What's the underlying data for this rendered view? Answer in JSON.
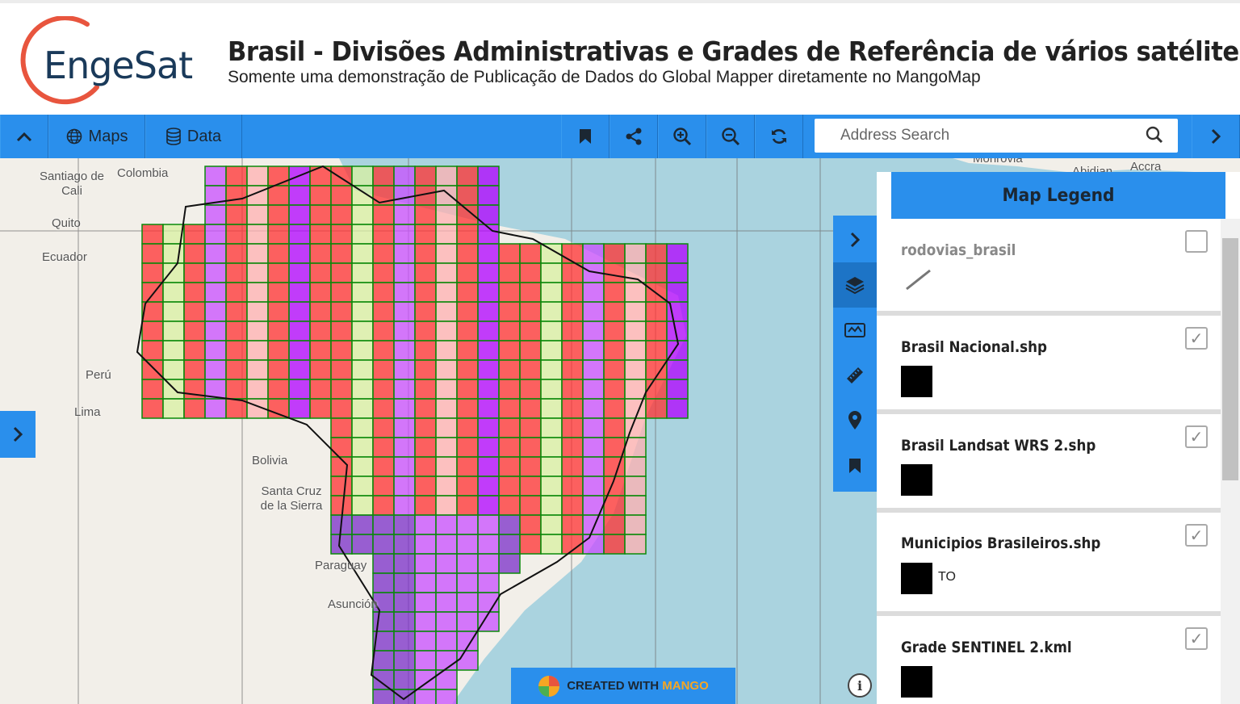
{
  "header": {
    "logo_text": "EngeSat",
    "title": "Brasil - Divisões Administrativas e Grades de Referência de vários satélites...",
    "subtitle": "Somente uma demonstração de Publicação de Dados do Global Mapper diretamente no MangoMap"
  },
  "toolbar": {
    "maps_label": "Maps",
    "data_label": "Data",
    "search_placeholder": "Address Search"
  },
  "map": {
    "place_labels": [
      "Santiago de Cali",
      "Colombia",
      "Quito",
      "Ecuador",
      "Perú",
      "Lima",
      "Bolivia",
      "Santa Cruz de la Sierra",
      "Paraguay",
      "Asunción",
      "Monrovia",
      "Abidjan",
      "Accra"
    ],
    "colors": {
      "grid_red": "#ff0000",
      "grid_green": "#0a8a0a",
      "ocean": "#aad3df",
      "land": "#f2efe9",
      "toolbar": "#2a8fec"
    }
  },
  "legend": {
    "title": "Map Legend",
    "items": [
      {
        "name": "rodovias_brasil",
        "checked": false,
        "swatch": "line"
      },
      {
        "name": "Brasil Nacional.shp",
        "checked": true,
        "swatch": "box"
      },
      {
        "name": "Brasil Landsat WRS 2.shp",
        "checked": true,
        "swatch": "box"
      },
      {
        "name": "Municipios Brasileiros.shp",
        "checked": true,
        "swatch": "box",
        "swatch_label": "TO"
      },
      {
        "name": "Grade SENTINEL 2.kml",
        "checked": true,
        "swatch": "box"
      }
    ]
  },
  "credit": {
    "prefix": "CREATED WITH ",
    "brand": "MANGO"
  },
  "icons": [
    "collapse-up-icon",
    "globe-icon",
    "database-icon",
    "bookmark-icon",
    "share-icon",
    "zoom-in-icon",
    "zoom-out-icon",
    "refresh-icon",
    "search-icon",
    "chevron-right-icon",
    "layers-icon",
    "map-icon",
    "ruler-icon",
    "location-pin-icon",
    "info-icon"
  ]
}
